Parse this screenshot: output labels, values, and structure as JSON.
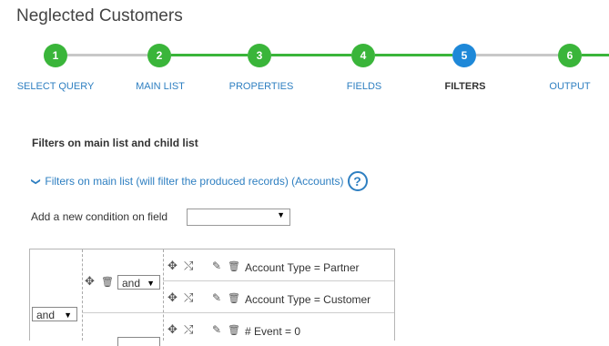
{
  "page": {
    "title": "Neglected Customers"
  },
  "wizard": {
    "steps": [
      {
        "number": "1",
        "label": "SELECT QUERY",
        "color": "#3ab53a"
      },
      {
        "number": "2",
        "label": "MAIN LIST",
        "color": "#3ab53a"
      },
      {
        "number": "3",
        "label": "PROPERTIES",
        "color": "#3ab53a"
      },
      {
        "number": "4",
        "label": "FIELDS",
        "color": "#3ab53a"
      },
      {
        "number": "5",
        "label": "FILTERS",
        "color": "#1e88d8"
      },
      {
        "number": "6",
        "label": "OUTPUT",
        "color": "#3ab53a"
      }
    ],
    "line_color_done": "#3ab53a",
    "line_color_pending": "#c8c8c8"
  },
  "filters": {
    "section_title": "Filters on main list and child list",
    "main_list_toggle": "Filters on main list (will filter the produced records) (Accounts)",
    "help_symbol": "?",
    "add_condition_label": "Add a new condition on field",
    "field_select_value": ""
  },
  "tree": {
    "root_operator": "and",
    "group_operator": "and",
    "conditions": [
      {
        "text": "Account Type = Partner"
      },
      {
        "text": "Account Type = Customer"
      },
      {
        "text": "# Event = 0"
      }
    ]
  },
  "icons": {
    "move": "✥",
    "split": "⤭",
    "edit": "✎",
    "delete": "🗑",
    "caret": "▼",
    "chevron": "❯"
  },
  "colors": {
    "link": "#2e7fc1",
    "done": "#3ab53a",
    "active": "#1e88d8"
  }
}
